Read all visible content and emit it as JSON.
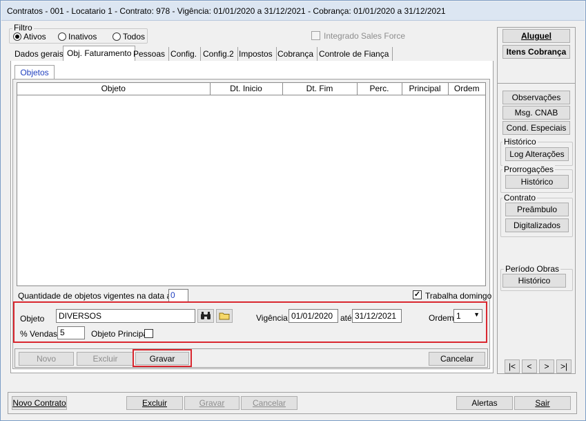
{
  "window": {
    "title": "Contratos - 001 - Locatario 1 - Contrato: 978 - Vigência: 01/01/2020 a 31/12/2021 - Cobrança: 01/01/2020 a 31/12/2021"
  },
  "filter": {
    "label": "Filtro",
    "options": [
      "Ativos",
      "Inativos",
      "Todos"
    ],
    "selected": "Ativos"
  },
  "integrado": {
    "label": "Integrado Sales Force",
    "checked": false
  },
  "tabs": [
    {
      "label": "Dados gerais"
    },
    {
      "label": "Obj. Faturamento"
    },
    {
      "label": "Pessoas"
    },
    {
      "label": "Config."
    },
    {
      "label": "Config.2"
    },
    {
      "label": "Impostos"
    },
    {
      "label": "Cobrança"
    },
    {
      "label": "Controle de Fiança"
    }
  ],
  "active_tab": "Obj. Faturamento",
  "subtab": {
    "label": "Objetos"
  },
  "grid": {
    "columns": [
      "Objeto",
      "Dt. Inicio",
      "Dt. Fim",
      "Perc.",
      "Principal",
      "Ordem"
    ],
    "rows": []
  },
  "quantidade": {
    "label": "Quantidade de objetos vigentes na data atual",
    "value": "0"
  },
  "trabalha_domingo": {
    "label": "Trabalha domingo",
    "checked": true
  },
  "form": {
    "objeto_label": "Objeto",
    "objeto_value": "DIVERSOS",
    "vigencia_label": "Vigência",
    "vigencia_inicio": "01/01/2020",
    "ate_label": "até",
    "vigencia_fim": "31/12/2021",
    "ordem_label": "Ordem",
    "ordem_value": "1",
    "vendas_label": "% Vendas",
    "vendas_value": "5",
    "principal_label": "Objeto Principal",
    "principal_checked": false
  },
  "form_buttons": {
    "novo": "Novo",
    "excluir": "Excluir",
    "gravar": "Gravar",
    "cancelar": "Cancelar"
  },
  "right_panel": {
    "aluguel": "Aluguel",
    "itens_cobranca": "Itens Cobrança",
    "observacoes": "Observações",
    "msg_cnab": "Msg. CNAB",
    "cond_especiais": "Cond. Especiais",
    "historico_group": "Histórico",
    "log_alteracoes": "Log Alterações",
    "prorrogacoes_group": "Prorrogações",
    "prorrogacoes_historico": "Histórico",
    "contrato_group": "Contrato",
    "preambulo": "Preâmbulo",
    "digitalizados": "Digitalizados",
    "periodo_obras_group": "Período Obras",
    "periodo_historico": "Histórico",
    "nav": [
      "|<",
      "<",
      ">",
      ">|"
    ]
  },
  "bottom_bar": {
    "novo_contrato": "Novo Contrato",
    "excluir": "Excluir",
    "gravar": "Gravar",
    "cancelar": "Cancelar",
    "alertas": "Alertas",
    "sair": "Sair"
  },
  "colors": {
    "highlight": "#d9262e",
    "link_blue": "#1f3fbf"
  }
}
